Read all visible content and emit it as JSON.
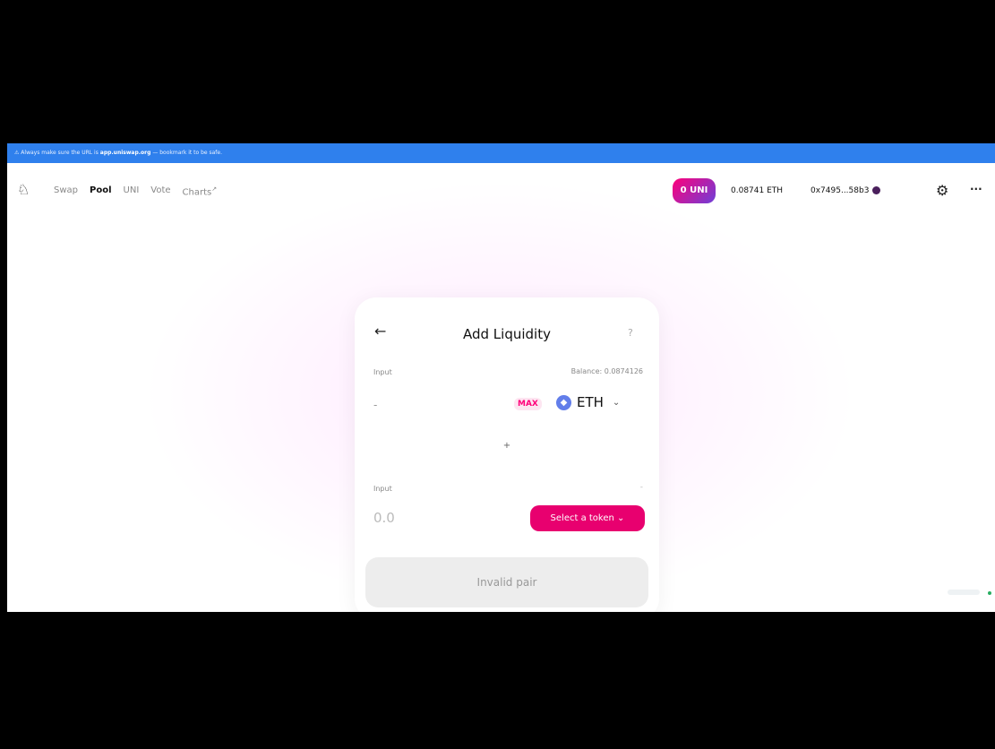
{
  "phishing_bar": {
    "text": "Always make sure the URL is",
    "url": "app.uniswap.org",
    "bookmark": "— bookmark it to be safe."
  },
  "header": {
    "logo_icon": "unicorn-icon",
    "nav": [
      {
        "label": "Swap"
      },
      {
        "label": "Pool"
      },
      {
        "label": "UNI"
      },
      {
        "label": "Vote"
      },
      {
        "label": "Charts",
        "suffix": "↗"
      }
    ],
    "uni_pill": "0 UNI",
    "eth_balance": "0.08741 ETH",
    "address": "0x7495...58b3",
    "settings_icon": "gear-icon",
    "more_icon": "dots-icon",
    "more_label": "···"
  },
  "card": {
    "back_icon": "arrow-left-icon",
    "back_label": "←",
    "title": "Add Liquidity",
    "help_icon": "question-icon",
    "help_label": "?",
    "input1": {
      "label": "Input",
      "balance": "Balance: 0.0874126",
      "amount": "-",
      "max": "MAX",
      "token": "ETH",
      "token_icon": "ether-icon",
      "chevron": "⌄"
    },
    "plus": "+",
    "input2": {
      "label": "Input",
      "dash": "-",
      "amount": "0.0",
      "button": "Select a token",
      "chevron": "⌄"
    },
    "submit": "Invalid pair"
  },
  "colors": {
    "accent": "#ff007a",
    "bar": "#2f80ed",
    "eth": "#627eea"
  }
}
